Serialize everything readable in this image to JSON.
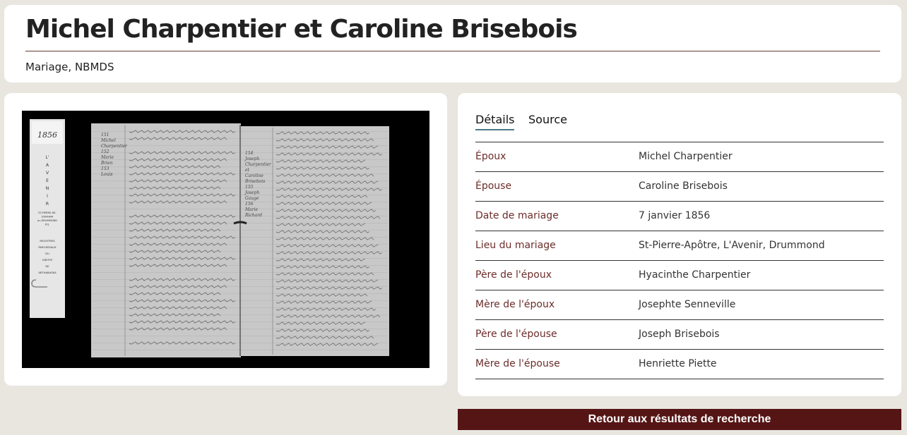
{
  "header": {
    "title": "Michel Charpentier et Caroline Brisebois",
    "subtitle": "Mariage, NBMDS"
  },
  "image": {
    "slip_year": "1856",
    "slip_letters": [
      "L'",
      "A",
      "V",
      "E",
      "N",
      "I",
      "R"
    ],
    "slip_parish": [
      "ST-PIERRE-DE-",
      "DURHAM",
      "ou DRUMMOND",
      "P.Q."
    ],
    "slip_registres": [
      "REGISTRES",
      "PAROISSIAUX",
      "DU",
      "GREFFE",
      "DE",
      "ARTHABASKA"
    ],
    "margin_left": [
      "151",
      "Michel",
      "Charpentier",
      "152",
      "Marie",
      "Brien",
      "153",
      "Louis"
    ],
    "margin_right": [
      "154",
      "Joseph",
      "Charpentier",
      "et",
      "Caroline",
      "Brisebois",
      "155",
      "Joseph",
      "Gauge",
      "156",
      "Marie",
      "Richard"
    ]
  },
  "tabs": [
    {
      "label": "Détails"
    },
    {
      "label": "Source"
    }
  ],
  "details": [
    {
      "label": "Époux",
      "value": "Michel Charpentier"
    },
    {
      "label": "Épouse",
      "value": "Caroline Brisebois"
    },
    {
      "label": "Date de mariage",
      "value": "7 janvier 1856"
    },
    {
      "label": "Lieu du mariage",
      "value": "St-Pierre-Apôtre, L'Avenir, Drummond"
    },
    {
      "label": "Père de l'époux",
      "value": "Hyacinthe Charpentier"
    },
    {
      "label": "Mère de l'époux",
      "value": "Josephte Senneville"
    },
    {
      "label": "Père de l'épouse",
      "value": "Joseph Brisebois"
    },
    {
      "label": "Mère de l'épouse",
      "value": "Henriette Piette"
    }
  ],
  "back_button": {
    "label": "Retour aux résultats de recherche"
  }
}
